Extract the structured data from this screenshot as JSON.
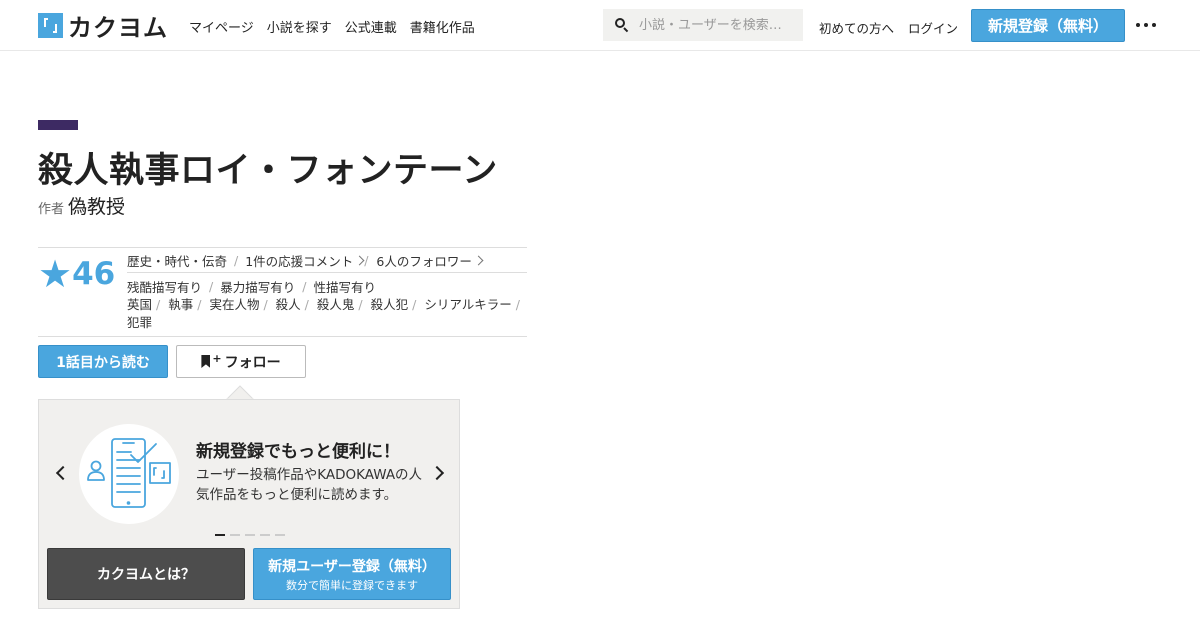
{
  "header": {
    "logo_text": "カクヨム",
    "nav": [
      "マイページ",
      "小説を探す",
      "公式連載",
      "書籍化作品"
    ],
    "search_placeholder": "小説・ユーザーを検索…",
    "first_time": "初めての方へ",
    "login": "ログイン",
    "register": "新規登録（無料）"
  },
  "work": {
    "title": "殺人執事ロイ・フォンテーン",
    "author_label": "作者",
    "author_name": "偽教授",
    "stars": "46",
    "genre": "歴史・時代・伝奇",
    "comments": "1件の応援コメント",
    "followers": "6人のフォロワー",
    "warnings": [
      "残酷描写有り",
      "暴力描写有り",
      "性描写有り"
    ],
    "tags": [
      "英国",
      "執事",
      "実在人物",
      "殺人",
      "殺人鬼",
      "殺人犯",
      "シリアルキラー",
      "犯罪"
    ]
  },
  "actions": {
    "read_first": "1話目から読む",
    "follow": "フォロー"
  },
  "promo": {
    "heading": "新規登録でもっと便利に！",
    "body": "ユーザー投稿作品やKADOKAWAの人気作品をもっと便利に読めます。",
    "about": "カクヨムとは？",
    "signup_main": "新規ユーザー登録（無料）",
    "signup_sub": "数分で簡単に登録できます"
  },
  "colors": {
    "brand_blue": "#4aa6de",
    "title_accent": "#3d2a63",
    "promo_bg": "#f1f0ee"
  }
}
